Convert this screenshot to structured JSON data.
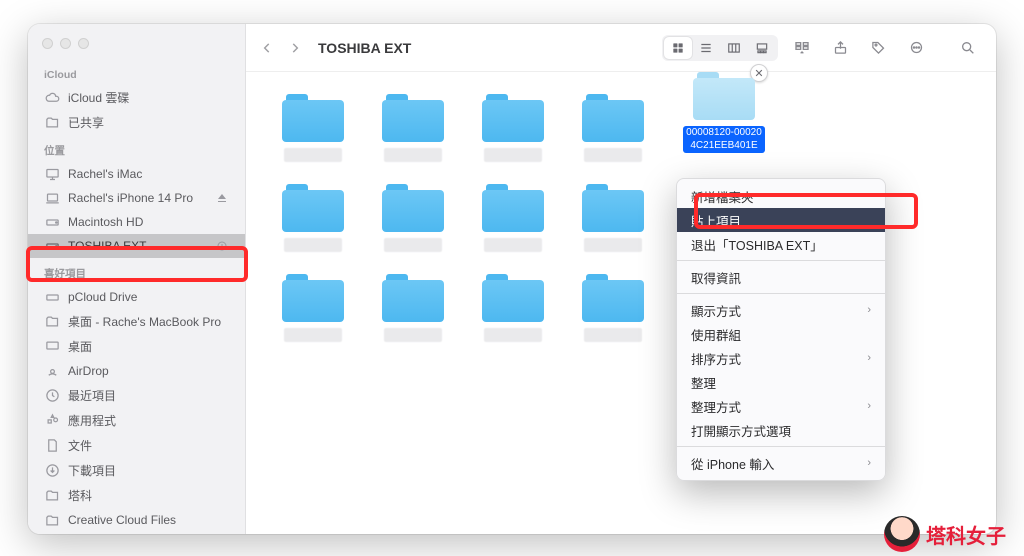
{
  "window_title": "TOSHIBA EXT",
  "sidebar": {
    "sections": [
      {
        "label": "iCloud",
        "items": [
          {
            "icon": "cloud-icon",
            "label": "iCloud 雲碟"
          },
          {
            "icon": "folder-shared-icon",
            "label": "已共享"
          }
        ]
      },
      {
        "label": "位置",
        "items": [
          {
            "icon": "desktop-icon",
            "label": "Rachel's iMac"
          },
          {
            "icon": "laptop-icon",
            "label": "Rachel's  iPhone 14 Pro",
            "eject": true
          },
          {
            "icon": "drive-icon",
            "label": "Macintosh HD"
          },
          {
            "icon": "drive-ext-icon",
            "label": "TOSHIBA EXT",
            "selected": true,
            "eject": true
          }
        ]
      },
      {
        "label": "喜好項目",
        "items": [
          {
            "icon": "cloud-drive-icon",
            "label": "pCloud Drive"
          },
          {
            "icon": "folder-icon",
            "label": "桌面 - Rache's MacBook Pro"
          },
          {
            "icon": "desktop-folder-icon",
            "label": "桌面"
          },
          {
            "icon": "airdrop-icon",
            "label": "AirDrop"
          },
          {
            "icon": "clock-icon",
            "label": "最近項目"
          },
          {
            "icon": "apps-icon",
            "label": "應用程式"
          },
          {
            "icon": "doc-icon",
            "label": "文件"
          },
          {
            "icon": "download-icon",
            "label": "下載項目"
          },
          {
            "icon": "folder-icon",
            "label": "塔科"
          },
          {
            "icon": "folder-icon",
            "label": "Creative Cloud Files"
          }
        ]
      }
    ]
  },
  "selected_item": {
    "name_line1": "00008120-00020",
    "name_line2": "4C21EEB401E"
  },
  "context_menu": {
    "items": [
      {
        "label": "新增檔案夾"
      },
      {
        "label": "貼上項目",
        "highlighted": true
      },
      {
        "label": "退出「TOSHIBA EXT」"
      },
      {
        "sep": true
      },
      {
        "label": "取得資訊"
      },
      {
        "sep": true
      },
      {
        "label": "顯示方式",
        "submenu": true
      },
      {
        "label": "使用群組"
      },
      {
        "label": "排序方式",
        "submenu": true
      },
      {
        "label": "整理"
      },
      {
        "label": "整理方式",
        "submenu": true
      },
      {
        "label": "打開顯示方式選項"
      },
      {
        "sep": true
      },
      {
        "label": "從 iPhone 輸入",
        "submenu": true
      }
    ]
  },
  "watermark": "塔科女子"
}
